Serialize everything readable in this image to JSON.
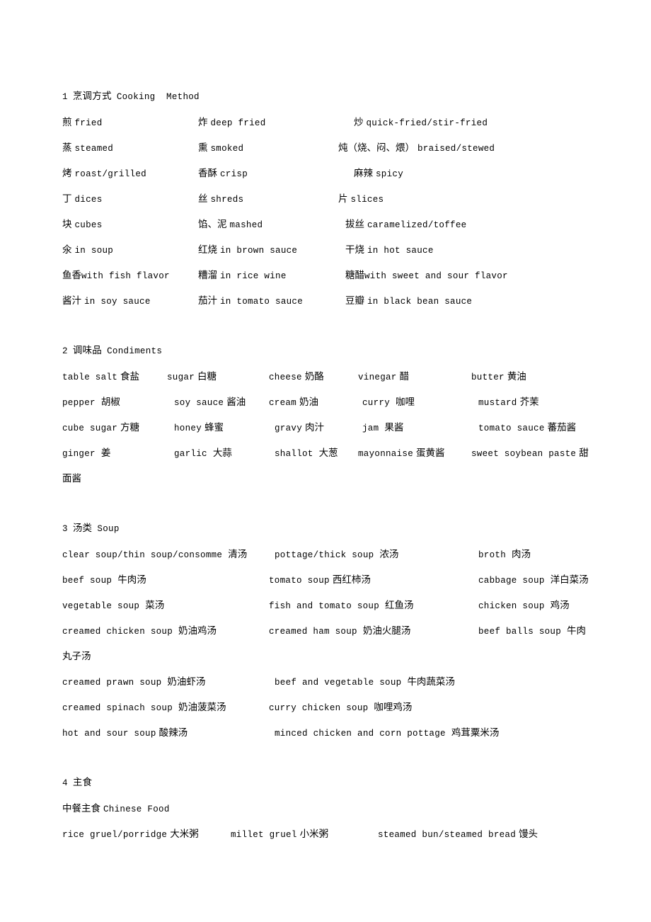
{
  "document": {
    "sections": [
      {
        "number": "1",
        "title_cn": "烹调方式",
        "title_en": "Cooking  Method",
        "rows": [
          {
            "c1_cn": "煎",
            "c1_en": "fried",
            "c2_cn": "炸",
            "c2_en": "deep  fried",
            "c3_cn": "炒",
            "c3_en": "quick-fried/stir-fried"
          },
          {
            "c1_cn": "蒸",
            "c1_en": "steamed",
            "c2_cn": "熏",
            "c2_en": "smoked",
            "c3_cn": "炖（烧、闷、煨）",
            "c3_en": "braised/stewed"
          },
          {
            "c1_cn": "烤",
            "c1_en": "roast/grilled",
            "c2_cn": "香酥",
            "c2_en": "crisp",
            "c3_cn": "麻辣",
            "c3_en": "spicy"
          },
          {
            "c1_cn": "丁",
            "c1_en": "dices",
            "c2_cn": "丝",
            "c2_en": "shreds",
            "c3_cn": "片",
            "c3_en": "slices"
          },
          {
            "c1_cn": "块",
            "c1_en": "cubes",
            "c2_cn": "馅、泥",
            "c2_en": "mashed",
            "c3_cn": "拔丝",
            "c3_en": "caramelized/toffee"
          },
          {
            "c1_cn": "氽",
            "c1_en": "in  soup",
            "c2_cn": "红烧",
            "c2_en": "in  brown  sauce",
            "c3_cn": "干烧",
            "c3_en": "in  hot  sauce"
          },
          {
            "c1_cn": "鱼香",
            "c1_en": "with  fish  flavor",
            "c2_cn": "糟溜",
            "c2_en": "in  rice  wine",
            "c3_cn": "糖醋",
            "c3_en": "with  sweet  and  sour  flavor"
          },
          {
            "c1_cn": "酱汁",
            "c1_en": "in  soy  sauce",
            "c2_cn": "茄汁",
            "c2_en": "in  tomato  sauce",
            "c3_cn": "豆瓣",
            "c3_en": "in  black  bean  sauce"
          }
        ]
      },
      {
        "number": "2",
        "title_cn": "调味品",
        "title_en": "Condiments",
        "rows": [
          {
            "c1_en": "table  salt",
            "c1_cn": "食盐",
            "c2_en": "sugar",
            "c2_cn": "白糖",
            "c3_en": "cheese",
            "c3_cn": "奶酪",
            "c4_en": "vinegar",
            "c4_cn": "醋",
            "c5_en": "butter",
            "c5_cn": "黄油"
          },
          {
            "c1_en": "pepper",
            "c1_cn": "胡椒",
            "c2_en": "soy  sauce",
            "c2_cn": "酱油",
            "c3_en": "cream",
            "c3_cn": "奶油",
            "c4_en": "curry",
            "c4_cn": "咖哩",
            "c5_en": "mustard",
            "c5_cn": "芥茉"
          },
          {
            "c1_en": "cube  sugar",
            "c1_cn": "方糖",
            "c2_en": "honey",
            "c2_cn": "蜂蜜",
            "c3_en": "gravy",
            "c3_cn": "肉汁",
            "c4_en": "jam",
            "c4_cn": "果酱",
            "c5_en": "tomato  sauce",
            "c5_cn": "蕃茄酱"
          },
          {
            "c1_en": "ginger",
            "c1_cn": "姜",
            "c2_en": "garlic",
            "c2_cn": "大蒜",
            "c3_en": "shallot",
            "c3_cn": "大葱",
            "c4_en": "mayonnaise",
            "c4_cn": "蛋黄酱",
            "c5_en": "sweet  soybean  paste",
            "c5_cn": "甜"
          }
        ],
        "wrap_line": "面酱"
      },
      {
        "number": "3",
        "title_cn": "汤类",
        "title_en": "Soup",
        "rows": [
          {
            "c1_en": "clear  soup/thin  soup/consomme",
            "c1_cn": "清汤",
            "c2_en": "pottage/thick  soup",
            "c2_cn": "浓汤",
            "c3_en": "broth",
            "c3_cn": "肉汤"
          },
          {
            "c1_en": "beef  soup",
            "c1_cn": "牛肉汤",
            "c2_en": "tomato  soup",
            "c2_cn": "西红柿汤",
            "c3_en": "cabbage  soup",
            "c3_cn": "洋白菜汤"
          },
          {
            "c1_en": "vegetable  soup",
            "c1_cn": "菜汤",
            "c2_en": "fish  and  tomato  soup",
            "c2_cn": "红鱼汤",
            "c3_en": "chicken  soup",
            "c3_cn": "鸡汤"
          },
          {
            "c1_en": "creamed  chicken  soup",
            "c1_cn": "奶油鸡汤",
            "c2_en": "creamed  ham  soup",
            "c2_cn": "奶油火腿汤",
            "c3_en": "beef  balls  soup",
            "c3_cn": "牛肉"
          }
        ],
        "wrap_line": "丸子汤",
        "rows2": [
          {
            "c1_en": "creamed  prawn  soup",
            "c1_cn": "奶油虾汤",
            "c2_en": "beef  and  vegetable  soup",
            "c2_cn": "牛肉蔬菜汤"
          },
          {
            "c1_en": "creamed  spinach  soup",
            "c1_cn": "奶油菠菜汤",
            "c2_en": "curry  chicken  soup",
            "c2_cn": "咖哩鸡汤"
          },
          {
            "c1_en": "hot  and  sour  soup",
            "c1_cn": "酸辣汤",
            "c2_en": "minced  chicken  and  corn  pottage",
            "c2_cn": "鸡茸粟米汤"
          }
        ]
      },
      {
        "number": "4",
        "title_cn": "主食",
        "title_en": "",
        "subtitle_cn": "中餐主食",
        "subtitle_en": "Chinese  Food",
        "rows": [
          {
            "c1_en": "rice  gruel/porridge",
            "c1_cn": "大米粥",
            "c2_en": "millet  gruel",
            "c2_cn": "小米粥",
            "c3_en": "steamed  bun/steamed  bread",
            "c3_cn": "馒头"
          }
        ]
      }
    ]
  }
}
